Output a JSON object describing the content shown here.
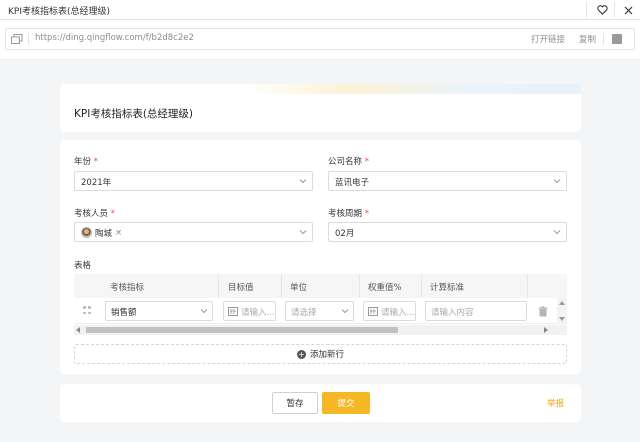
{
  "window": {
    "title": "KPI考核指标表(总经理级)"
  },
  "addressbar": {
    "url": "https://ding.qingflow.com/f/b2d8c2e2",
    "open_link_label": "打开链接",
    "copy_label": "复制"
  },
  "header": {
    "form_title": "KPI考核指标表(总经理级)"
  },
  "fields": {
    "year": {
      "label": "年份",
      "required_mark": "*",
      "value": "2021年"
    },
    "company": {
      "label": "公司名称",
      "required_mark": "*",
      "value": "蓝讯电子"
    },
    "assessee": {
      "label": "考核人员",
      "required_mark": "*",
      "tag": "陶城",
      "remove": "×"
    },
    "period": {
      "label": "考核周期",
      "required_mark": "*",
      "value": "02月"
    }
  },
  "table": {
    "label": "表格",
    "columns": [
      "考核指标",
      "目标值",
      "单位",
      "权重值%",
      "计算标准"
    ],
    "rows": [
      {
        "indicator": "销售额",
        "target_placeholder": "请输入...",
        "unit_placeholder": "请选择",
        "weight_placeholder": "请输入...",
        "standard_placeholder": "请输入内容"
      }
    ],
    "add_row_label": "添加新行"
  },
  "footer": {
    "draft_label": "暂存",
    "submit_label": "提交",
    "report_label": "举报"
  },
  "colors": {
    "accent": "#f5b723",
    "required": "#f04a3a",
    "report": "#f0a810"
  }
}
